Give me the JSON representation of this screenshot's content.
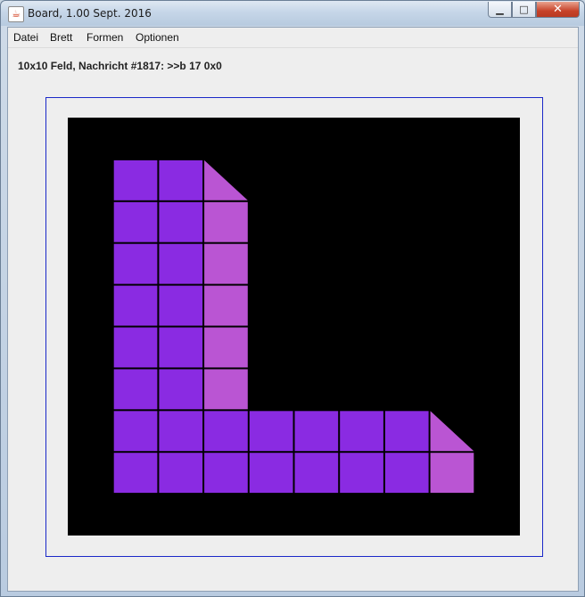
{
  "window": {
    "title": "Board, 1.00 Sept. 2016",
    "app_icon": "java-cup-icon",
    "controls": {
      "minimize": "▁",
      "maximize": "□",
      "close": "✕"
    }
  },
  "menubar": {
    "items": [
      "Datei",
      "Brett",
      "Formen",
      "Optionen"
    ]
  },
  "status": {
    "text": "10x10 Feld, Nachricht #1817: >>b 17 0x0"
  },
  "board": {
    "rows": 10,
    "cols": 10,
    "colors": {
      "background": "#000000",
      "violet": "#8a2be2",
      "orchid": "#ba55d3"
    },
    "cells": [
      {
        "r": 1,
        "c": 1,
        "color": "violet",
        "shape": "square"
      },
      {
        "r": 1,
        "c": 2,
        "color": "violet",
        "shape": "square"
      },
      {
        "r": 1,
        "c": 3,
        "color": "orchid",
        "shape": "triangle"
      },
      {
        "r": 2,
        "c": 1,
        "color": "violet",
        "shape": "square"
      },
      {
        "r": 2,
        "c": 2,
        "color": "violet",
        "shape": "square"
      },
      {
        "r": 2,
        "c": 3,
        "color": "orchid",
        "shape": "square"
      },
      {
        "r": 3,
        "c": 1,
        "color": "violet",
        "shape": "square"
      },
      {
        "r": 3,
        "c": 2,
        "color": "violet",
        "shape": "square"
      },
      {
        "r": 3,
        "c": 3,
        "color": "orchid",
        "shape": "square"
      },
      {
        "r": 4,
        "c": 1,
        "color": "violet",
        "shape": "square"
      },
      {
        "r": 4,
        "c": 2,
        "color": "violet",
        "shape": "square"
      },
      {
        "r": 4,
        "c": 3,
        "color": "orchid",
        "shape": "square"
      },
      {
        "r": 5,
        "c": 1,
        "color": "violet",
        "shape": "square"
      },
      {
        "r": 5,
        "c": 2,
        "color": "violet",
        "shape": "square"
      },
      {
        "r": 5,
        "c": 3,
        "color": "orchid",
        "shape": "square"
      },
      {
        "r": 6,
        "c": 1,
        "color": "violet",
        "shape": "square"
      },
      {
        "r": 6,
        "c": 2,
        "color": "violet",
        "shape": "square"
      },
      {
        "r": 6,
        "c": 3,
        "color": "orchid",
        "shape": "square"
      },
      {
        "r": 7,
        "c": 1,
        "color": "violet",
        "shape": "square"
      },
      {
        "r": 7,
        "c": 2,
        "color": "violet",
        "shape": "square"
      },
      {
        "r": 7,
        "c": 3,
        "color": "violet",
        "shape": "square"
      },
      {
        "r": 7,
        "c": 4,
        "color": "violet",
        "shape": "square"
      },
      {
        "r": 7,
        "c": 5,
        "color": "violet",
        "shape": "square"
      },
      {
        "r": 7,
        "c": 6,
        "color": "violet",
        "shape": "square"
      },
      {
        "r": 7,
        "c": 7,
        "color": "violet",
        "shape": "square"
      },
      {
        "r": 7,
        "c": 8,
        "color": "orchid",
        "shape": "triangle"
      },
      {
        "r": 8,
        "c": 1,
        "color": "violet",
        "shape": "square"
      },
      {
        "r": 8,
        "c": 2,
        "color": "violet",
        "shape": "square"
      },
      {
        "r": 8,
        "c": 3,
        "color": "violet",
        "shape": "square"
      },
      {
        "r": 8,
        "c": 4,
        "color": "violet",
        "shape": "square"
      },
      {
        "r": 8,
        "c": 5,
        "color": "violet",
        "shape": "square"
      },
      {
        "r": 8,
        "c": 6,
        "color": "violet",
        "shape": "square"
      },
      {
        "r": 8,
        "c": 7,
        "color": "violet",
        "shape": "square"
      },
      {
        "r": 8,
        "c": 8,
        "color": "orchid",
        "shape": "square"
      }
    ]
  }
}
